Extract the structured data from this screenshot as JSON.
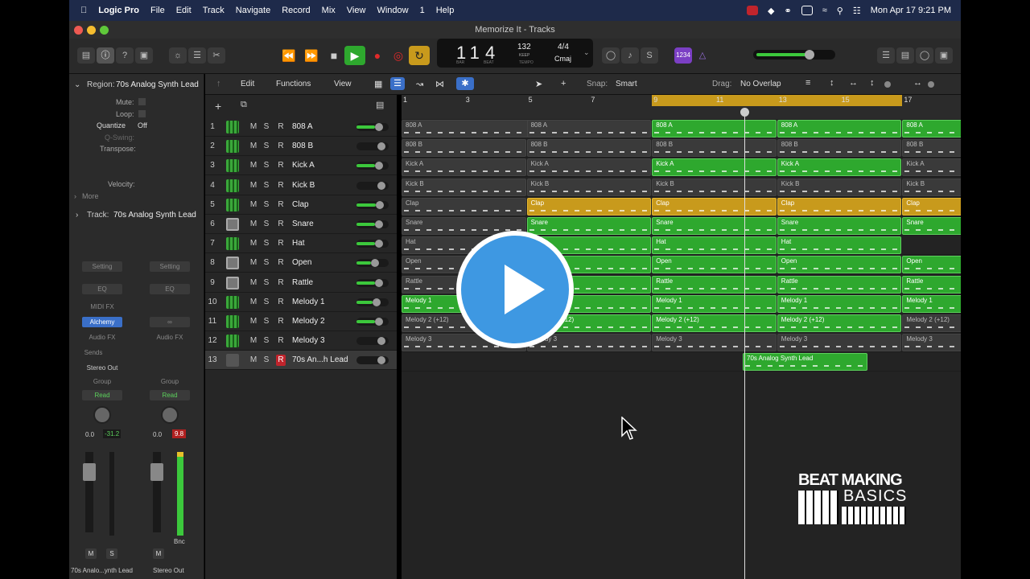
{
  "menubar": {
    "app": "Logic Pro",
    "items": [
      "File",
      "Edit",
      "Track",
      "Navigate",
      "Record",
      "Mix",
      "View",
      "Window",
      "1",
      "Help"
    ],
    "clock": "Mon Apr 17  9:21 PM"
  },
  "window": {
    "title": "Memorize It - Tracks"
  },
  "lcd": {
    "bar": "11",
    "beat": "4",
    "bar_label": "BAR",
    "beat_label": "BEAT",
    "tempo": "132",
    "tempo_label": "KEEP",
    "tempo_sub": "TEMPO",
    "time_sig": "4/4",
    "key": "Cmaj"
  },
  "toolbar_badge": "1234",
  "inspector": {
    "region_header": "Region:",
    "region_name": "70s Analog Synth Lead",
    "mute": "Mute:",
    "loop": "Loop:",
    "quantize_label": "Quantize",
    "quantize_value": "Off",
    "qswing": "Q-Swing:",
    "transpose": "Transpose:",
    "velocity": "Velocity:",
    "more": "More",
    "track_header": "Track:",
    "track_name": "70s Analog Synth Lead",
    "strip1": {
      "setting": "Setting",
      "eq": "EQ",
      "midifx": "MIDI FX",
      "instrument": "Alchemy",
      "audiofx": "Audio FX",
      "sends": "Sends",
      "output": "Stereo Out",
      "group": "Group",
      "automation": "Read",
      "pan": "0.0",
      "level": "-31.2",
      "mute": "M",
      "solo": "S",
      "name": "70s Analo...ynth Lead"
    },
    "strip2": {
      "setting": "Setting",
      "eq": "EQ",
      "audiofx": "Audio FX",
      "group": "Group",
      "automation": "Read",
      "pan": "0.0",
      "level": "9.8",
      "mute": "M",
      "bounce": "Bnc",
      "name": "Stereo Out"
    }
  },
  "tracks_toolbar": {
    "edit": "Edit",
    "functions": "Functions",
    "view": "View",
    "snap_label": "Snap:",
    "snap_value": "Smart",
    "drag_label": "Drag:",
    "drag_value": "No Overlap"
  },
  "ruler": [
    "1",
    "3",
    "5",
    "7",
    "9",
    "11",
    "13",
    "15",
    "17"
  ],
  "tracks": [
    {
      "num": "1",
      "name": "808 A",
      "icon": "synth",
      "fader": 0.75
    },
    {
      "num": "2",
      "name": "808 B",
      "icon": "synth",
      "fader": 0.0
    },
    {
      "num": "3",
      "name": "Kick A",
      "icon": "synth",
      "fader": 0.75
    },
    {
      "num": "4",
      "name": "Kick B",
      "icon": "synth",
      "fader": 0.0
    },
    {
      "num": "5",
      "name": "Clap",
      "icon": "synth",
      "fader": 0.8
    },
    {
      "num": "6",
      "name": "Snare",
      "icon": "drum",
      "fader": 0.75
    },
    {
      "num": "7",
      "name": "Hat",
      "icon": "synth",
      "fader": 0.75
    },
    {
      "num": "8",
      "name": "Open",
      "icon": "drum",
      "fader": 0.6
    },
    {
      "num": "9",
      "name": "Rattle",
      "icon": "drum",
      "fader": 0.75
    },
    {
      "num": "10",
      "name": "Melody 1",
      "icon": "synth",
      "fader": 0.65
    },
    {
      "num": "11",
      "name": "Melody 2",
      "icon": "synth",
      "fader": 0.75
    },
    {
      "num": "12",
      "name": "Melody 3",
      "icon": "synth",
      "fader": 0.0
    },
    {
      "num": "13",
      "name": "70s An...h Lead",
      "icon": "keys",
      "fader": 0.0
    }
  ],
  "track_buttons": {
    "mute": "M",
    "solo": "S",
    "record": "R"
  },
  "regions": [
    [
      {
        "label": "808 A",
        "c": "gray",
        "from": 1,
        "to": 9
      },
      {
        "label": "808 A",
        "c": "gray",
        "from": 5,
        "to": 9
      },
      {
        "label": "808 A",
        "c": "green",
        "from": 9,
        "to": 13
      },
      {
        "label": "808 A",
        "c": "green",
        "from": 13,
        "to": 17
      },
      {
        "label": "808 A",
        "c": "green",
        "from": 17,
        "to": 19
      }
    ],
    [
      {
        "label": "808 B",
        "c": "gray",
        "from": 1,
        "to": 5
      },
      {
        "label": "808 B",
        "c": "gray",
        "from": 5,
        "to": 9
      },
      {
        "label": "808 B",
        "c": "gray",
        "from": 9,
        "to": 13
      },
      {
        "label": "808 B",
        "c": "gray",
        "from": 13,
        "to": 17
      },
      {
        "label": "808 B",
        "c": "gray",
        "from": 17,
        "to": 19
      }
    ],
    [
      {
        "label": "Kick A",
        "c": "gray",
        "from": 1,
        "to": 5
      },
      {
        "label": "Kick A",
        "c": "gray",
        "from": 5,
        "to": 9
      },
      {
        "label": "Kick A",
        "c": "green",
        "from": 9,
        "to": 13
      },
      {
        "label": "Kick A",
        "c": "green",
        "from": 13,
        "to": 17
      },
      {
        "label": "Kick A",
        "c": "gray",
        "from": 17,
        "to": 19
      }
    ],
    [
      {
        "label": "Kick B",
        "c": "gray",
        "from": 1,
        "to": 5
      },
      {
        "label": "Kick B",
        "c": "gray",
        "from": 5,
        "to": 9
      },
      {
        "label": "Kick B",
        "c": "gray",
        "from": 9,
        "to": 13
      },
      {
        "label": "Kick B",
        "c": "gray",
        "from": 13,
        "to": 17
      },
      {
        "label": "Kick B",
        "c": "gray",
        "from": 17,
        "to": 19
      }
    ],
    [
      {
        "label": "Clap",
        "c": "gray",
        "from": 1,
        "to": 5
      },
      {
        "label": "Clap",
        "c": "yellow",
        "from": 5,
        "to": 9
      },
      {
        "label": "Clap",
        "c": "yellow",
        "from": 9,
        "to": 13
      },
      {
        "label": "Clap",
        "c": "yellow",
        "from": 13,
        "to": 17
      },
      {
        "label": "Clap",
        "c": "yellow",
        "from": 17,
        "to": 19
      }
    ],
    [
      {
        "label": "Snare",
        "c": "gray",
        "from": 1,
        "to": 5
      },
      {
        "label": "Snare",
        "c": "green",
        "from": 5,
        "to": 9
      },
      {
        "label": "Snare",
        "c": "green",
        "from": 9,
        "to": 13
      },
      {
        "label": "Snare",
        "c": "green",
        "from": 13,
        "to": 17
      },
      {
        "label": "Snare",
        "c": "green",
        "from": 17,
        "to": 19
      }
    ],
    [
      {
        "label": "Hat",
        "c": "gray",
        "from": 1,
        "to": 5
      },
      {
        "label": "Hat",
        "c": "green",
        "from": 5,
        "to": 9
      },
      {
        "label": "Hat",
        "c": "green",
        "from": 9,
        "to": 13
      },
      {
        "label": "Hat",
        "c": "green",
        "from": 13,
        "to": 17
      }
    ],
    [
      {
        "label": "Open",
        "c": "gray",
        "from": 1,
        "to": 5
      },
      {
        "label": "Open",
        "c": "green",
        "from": 5,
        "to": 9
      },
      {
        "label": "Open",
        "c": "green",
        "from": 9,
        "to": 13
      },
      {
        "label": "Open",
        "c": "green",
        "from": 13,
        "to": 17
      },
      {
        "label": "Open",
        "c": "green",
        "from": 17,
        "to": 19
      }
    ],
    [
      {
        "label": "Rattle",
        "c": "gray",
        "from": 1,
        "to": 5
      },
      {
        "label": "Rattle",
        "c": "green",
        "from": 5,
        "to": 9
      },
      {
        "label": "Rattle",
        "c": "green",
        "from": 9,
        "to": 13
      },
      {
        "label": "Rattle",
        "c": "green",
        "from": 13,
        "to": 17
      },
      {
        "label": "Rattle",
        "c": "green",
        "from": 17,
        "to": 19
      }
    ],
    [
      {
        "label": "Melody 1",
        "c": "green",
        "from": 1,
        "to": 5
      },
      {
        "label": "Melody 1",
        "c": "green",
        "from": 5,
        "to": 9
      },
      {
        "label": "Melody 1",
        "c": "green",
        "from": 9,
        "to": 13
      },
      {
        "label": "Melody 1",
        "c": "green",
        "from": 13,
        "to": 17
      },
      {
        "label": "Melody 1",
        "c": "green",
        "from": 17,
        "to": 19
      }
    ],
    [
      {
        "label": "Melody 2 (+12)",
        "c": "gray",
        "from": 1,
        "to": 5
      },
      {
        "label": "Melody 2 (+12)",
        "c": "green",
        "from": 5,
        "to": 9
      },
      {
        "label": "Melody 2 (+12)",
        "c": "green",
        "from": 9,
        "to": 13
      },
      {
        "label": "Melody 2 (+12)",
        "c": "green",
        "from": 13,
        "to": 17
      },
      {
        "label": "Melody 2 (+12)",
        "c": "gray",
        "from": 17,
        "to": 19
      }
    ],
    [
      {
        "label": "Melody 3",
        "c": "gray",
        "from": 1,
        "to": 5
      },
      {
        "label": "Melody 3",
        "c": "gray",
        "from": 5,
        "to": 9
      },
      {
        "label": "Melody 3",
        "c": "gray",
        "from": 9,
        "to": 13
      },
      {
        "label": "Melody 3",
        "c": "gray",
        "from": 13,
        "to": 17
      },
      {
        "label": "Melody 3",
        "c": "gray",
        "from": 17,
        "to": 19
      }
    ],
    [
      {
        "label": "70s Analog Synth Lead",
        "c": "green",
        "from": 11.9,
        "to": 15.9
      }
    ]
  ],
  "logo": {
    "line1": "BEAT MAKING",
    "line2": "BASICS"
  },
  "colors": {
    "region_green": "#2ea82e",
    "region_yellow": "#c89a1c",
    "region_gray": "#3a3a3a",
    "play_blue": "#3e98e2",
    "record_red": "#c0242c"
  }
}
